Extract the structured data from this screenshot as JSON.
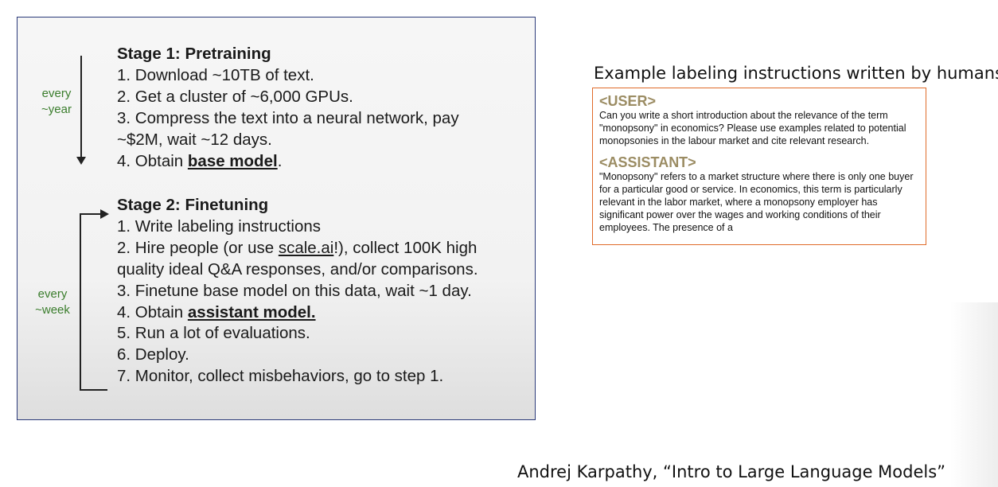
{
  "slide": {
    "stage1": {
      "title": "Stage 1: Pretraining",
      "step1": "1. Download ~10TB of text.",
      "step2": "2. Get a cluster of ~6,000 GPUs.",
      "step3a": "3. Compress the text into a neural network, pay",
      "step3b": "~$2M, wait ~12 days.",
      "step4_prefix": "4. Obtain ",
      "step4_bold": "base model",
      "step4_suffix": "."
    },
    "stage1_freq": {
      "line1": "every",
      "line2": "~year"
    },
    "stage2": {
      "title": "Stage 2: Finetuning",
      "step1": "1. Write labeling instructions",
      "step2_prefix": "2. Hire people (or use ",
      "step2_link": "scale.ai",
      "step2_suffix": "!), collect 100K high",
      "step2b": "quality ideal Q&A responses, and/or comparisons.",
      "step3": "3. Finetune base model on this data, wait ~1 day.",
      "step4_prefix": "4. Obtain ",
      "step4_bold": "assistant model.",
      "step5": "5. Run a lot of evaluations.",
      "step6": "6. Deploy.",
      "step7": "7. Monitor, collect misbehaviors, go to step 1."
    },
    "stage2_freq": {
      "line1": "every",
      "line2": "~week"
    }
  },
  "example": {
    "title": "Example labeling instructions written by humans",
    "user_tag": "<USER>",
    "user_text": "Can you write a short introduction about the relevance of the term \"monopsony\" in economics? Please use examples related to potential monopsonies in the labour market and cite relevant research.",
    "assistant_tag": "<ASSISTANT>",
    "assistant_text": "\"Monopsony\" refers to a market structure where there is only one buyer for a particular good or service. In economics, this term is particularly relevant in the labor market, where a monopsony employer has significant power over the wages and working conditions of their employees. The presence of a"
  },
  "caption": "Andrej Karpathy, “Intro to Large Language Models”",
  "colors": {
    "frequency_text": "#3a7d2c",
    "example_border": "#e06b2a",
    "tag": "#9b8c63",
    "slide_border": "#2b3a7a"
  }
}
